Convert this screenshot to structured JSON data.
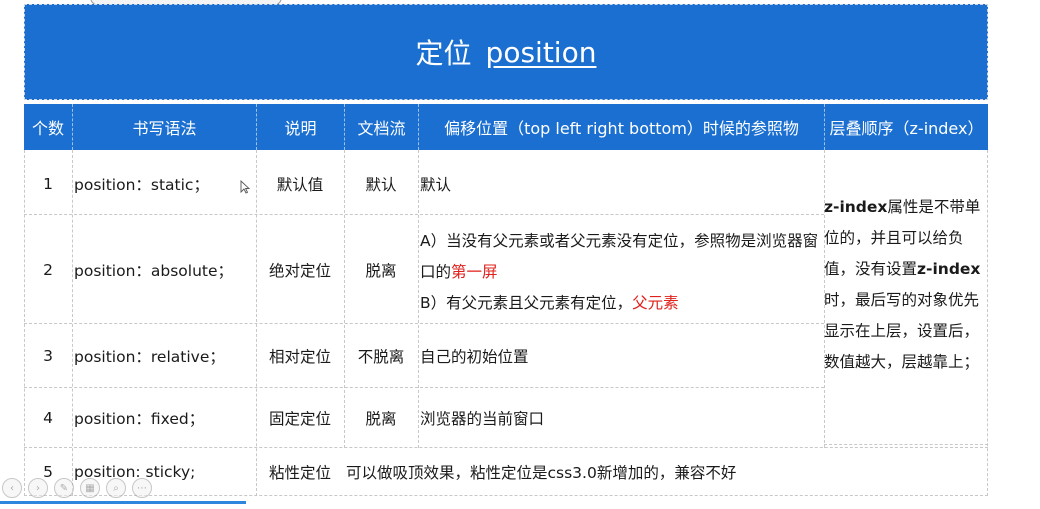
{
  "title": {
    "zh": "定位",
    "en": "position"
  },
  "headers": [
    "个数",
    "书写语法",
    "说明",
    "文档流",
    "偏移位置（top  left  right  bottom）时候的参照物",
    "层叠顺序（z-index）"
  ],
  "rows": [
    {
      "num": "1",
      "syntax": "position：static；",
      "desc": "默认值",
      "flow": "默认",
      "ref": "默认"
    },
    {
      "num": "2",
      "syntax": "position：absolute；",
      "desc": "绝对定位",
      "flow": "脱离",
      "ref_a1": "A）当没有父元素或者父元素没有定位，参照物是浏览器窗口的",
      "ref_a_red": "第一屏",
      "ref_b1": "B）有父元素且父元素有定位，",
      "ref_b_red": "父元素"
    },
    {
      "num": "3",
      "syntax": "position：relative；",
      "desc": "相对定位",
      "flow": "不脱离",
      "ref": "自己的初始位置"
    },
    {
      "num": "4",
      "syntax": "position：fixed；",
      "desc": "固定定位",
      "flow": "脱离",
      "ref": "浏览器的当前窗口"
    },
    {
      "num": "5",
      "syntax": "position: sticky;",
      "desc": "粘性定位",
      "note": "可以做吸顶效果，粘性定位是css3.0新增加的，兼容不好"
    }
  ],
  "zindex": {
    "bold1": "z-index",
    "t1": "属性是不带单位的，并且可以给负值，没有设置",
    "bold2": "z-index",
    "t2": "时，最后写的对象优先显示在上层，设置后，数值越大，层越靠上；"
  },
  "colors": {
    "header_bg": "#1a6fd1",
    "highlight": "#e0201b"
  }
}
